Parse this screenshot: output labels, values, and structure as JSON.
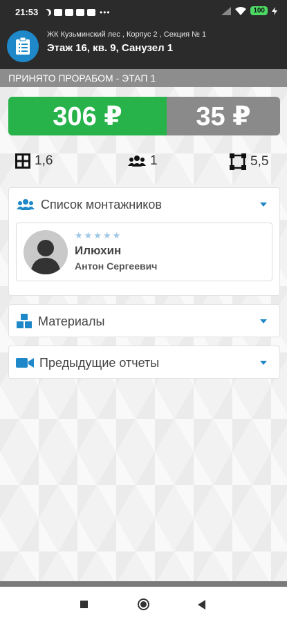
{
  "status": {
    "time": "21:53",
    "battery": "100"
  },
  "header": {
    "subtitle": "ЖК Кузьминский лес , Корпус 2 , Секция № 1",
    "title": "Этаж 16, кв. 9, Санузел 1"
  },
  "stage": "ПРИНЯТО ПРОРАБОМ - ЭТАП 1",
  "prices": {
    "primary": "306 ₽",
    "secondary": "35 ₽"
  },
  "stats": {
    "area": "1,6",
    "workers": "1",
    "perimeter": "5,5"
  },
  "sections": {
    "installers": {
      "label": "Список монтажников",
      "workers": [
        {
          "surname": "Илюхин",
          "patronymic": "Антон Сергеевич",
          "stars": "★★★★★"
        }
      ]
    },
    "materials": {
      "label": "Материалы"
    },
    "reports": {
      "label": "Предыдущие отчеты"
    }
  },
  "colors": {
    "accent": "#1e88c8",
    "green": "#27b24a",
    "grey": "#8a8a8a"
  }
}
